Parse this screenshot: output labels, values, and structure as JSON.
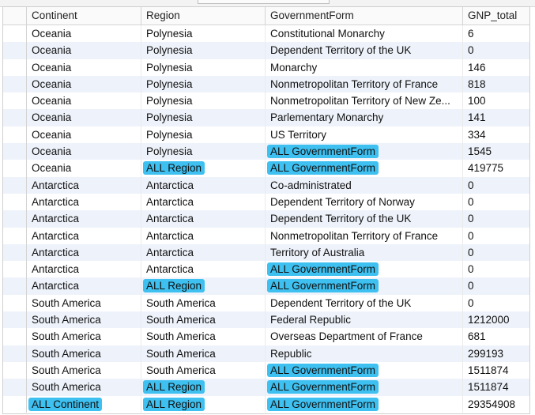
{
  "columns": [
    "Continent",
    "Region",
    "GovernmentForm",
    "GNP_total"
  ],
  "highlight_color": "#3ec0f0",
  "rows": [
    {
      "continent": "Oceania",
      "region": "Polynesia",
      "government_form": "Constitutional Monarchy",
      "gnp_total": "6"
    },
    {
      "continent": "Oceania",
      "region": "Polynesia",
      "government_form": "Dependent Territory of the UK",
      "gnp_total": "0"
    },
    {
      "continent": "Oceania",
      "region": "Polynesia",
      "government_form": "Monarchy",
      "gnp_total": "146"
    },
    {
      "continent": "Oceania",
      "region": "Polynesia",
      "government_form": "Nonmetropolitan Territory of France",
      "gnp_total": "818"
    },
    {
      "continent": "Oceania",
      "region": "Polynesia",
      "government_form": "Nonmetropolitan Territory of New Ze...",
      "gnp_total": "100"
    },
    {
      "continent": "Oceania",
      "region": "Polynesia",
      "government_form": "Parlementary Monarchy",
      "gnp_total": "141"
    },
    {
      "continent": "Oceania",
      "region": "Polynesia",
      "government_form": "US Territory",
      "gnp_total": "334"
    },
    {
      "continent": "Oceania",
      "region": "Polynesia",
      "government_form": "ALL GovernmentForm",
      "gnp_total": "1545",
      "hl_gov": true
    },
    {
      "continent": "Oceania",
      "region": "ALL Region",
      "government_form": "ALL GovernmentForm",
      "gnp_total": "419775",
      "hl_region": true,
      "hl_gov": true
    },
    {
      "continent": "Antarctica",
      "region": "Antarctica",
      "government_form": "Co-administrated",
      "gnp_total": "0"
    },
    {
      "continent": "Antarctica",
      "region": "Antarctica",
      "government_form": "Dependent Territory of Norway",
      "gnp_total": "0"
    },
    {
      "continent": "Antarctica",
      "region": "Antarctica",
      "government_form": "Dependent Territory of the UK",
      "gnp_total": "0"
    },
    {
      "continent": "Antarctica",
      "region": "Antarctica",
      "government_form": "Nonmetropolitan Territory of France",
      "gnp_total": "0"
    },
    {
      "continent": "Antarctica",
      "region": "Antarctica",
      "government_form": "Territory of Australia",
      "gnp_total": "0"
    },
    {
      "continent": "Antarctica",
      "region": "Antarctica",
      "government_form": "ALL GovernmentForm",
      "gnp_total": "0",
      "hl_gov": true
    },
    {
      "continent": "Antarctica",
      "region": "ALL Region",
      "government_form": "ALL GovernmentForm",
      "gnp_total": "0",
      "hl_region": true,
      "hl_gov": true
    },
    {
      "continent": "South America",
      "region": "South America",
      "government_form": "Dependent Territory of the UK",
      "gnp_total": "0"
    },
    {
      "continent": "South America",
      "region": "South America",
      "government_form": "Federal Republic",
      "gnp_total": "1212000"
    },
    {
      "continent": "South America",
      "region": "South America",
      "government_form": "Overseas Department of France",
      "gnp_total": "681"
    },
    {
      "continent": "South America",
      "region": "South America",
      "government_form": "Republic",
      "gnp_total": "299193"
    },
    {
      "continent": "South America",
      "region": "South America",
      "government_form": "ALL GovernmentForm",
      "gnp_total": "1511874",
      "hl_gov": true
    },
    {
      "continent": "South America",
      "region": "ALL Region",
      "government_form": "ALL GovernmentForm",
      "gnp_total": "1511874",
      "hl_region": true,
      "hl_gov": true
    },
    {
      "continent": "ALL Continent",
      "region": "ALL Region",
      "government_form": "ALL GovernmentForm",
      "gnp_total": "29354908",
      "hl_continent": true,
      "hl_region": true,
      "hl_gov": true
    }
  ]
}
